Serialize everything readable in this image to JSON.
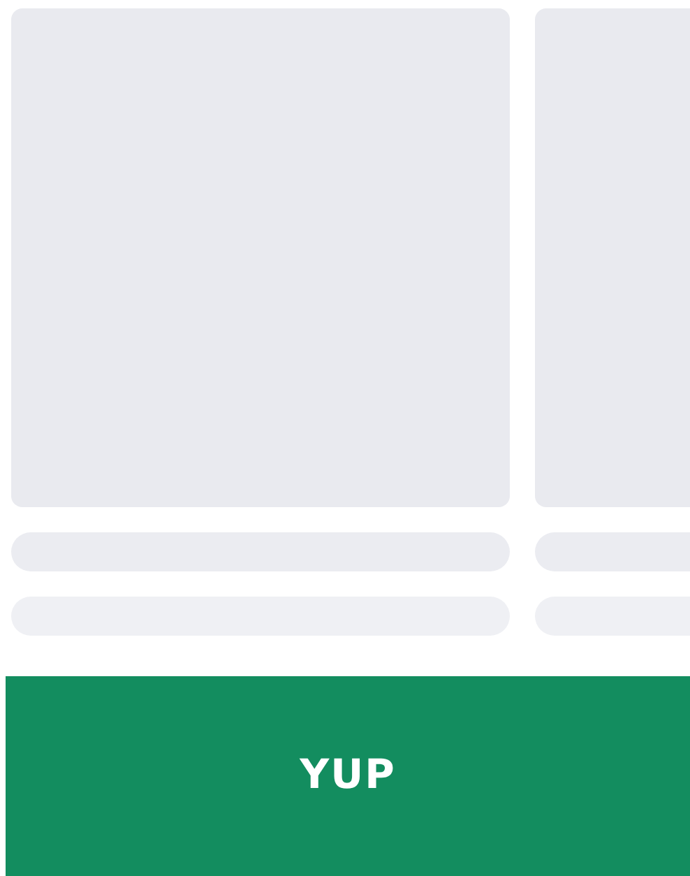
{
  "cards": [
    {
      "kind": "skeleton"
    },
    {
      "kind": "skeleton"
    }
  ],
  "button": {
    "label": "YUP"
  }
}
